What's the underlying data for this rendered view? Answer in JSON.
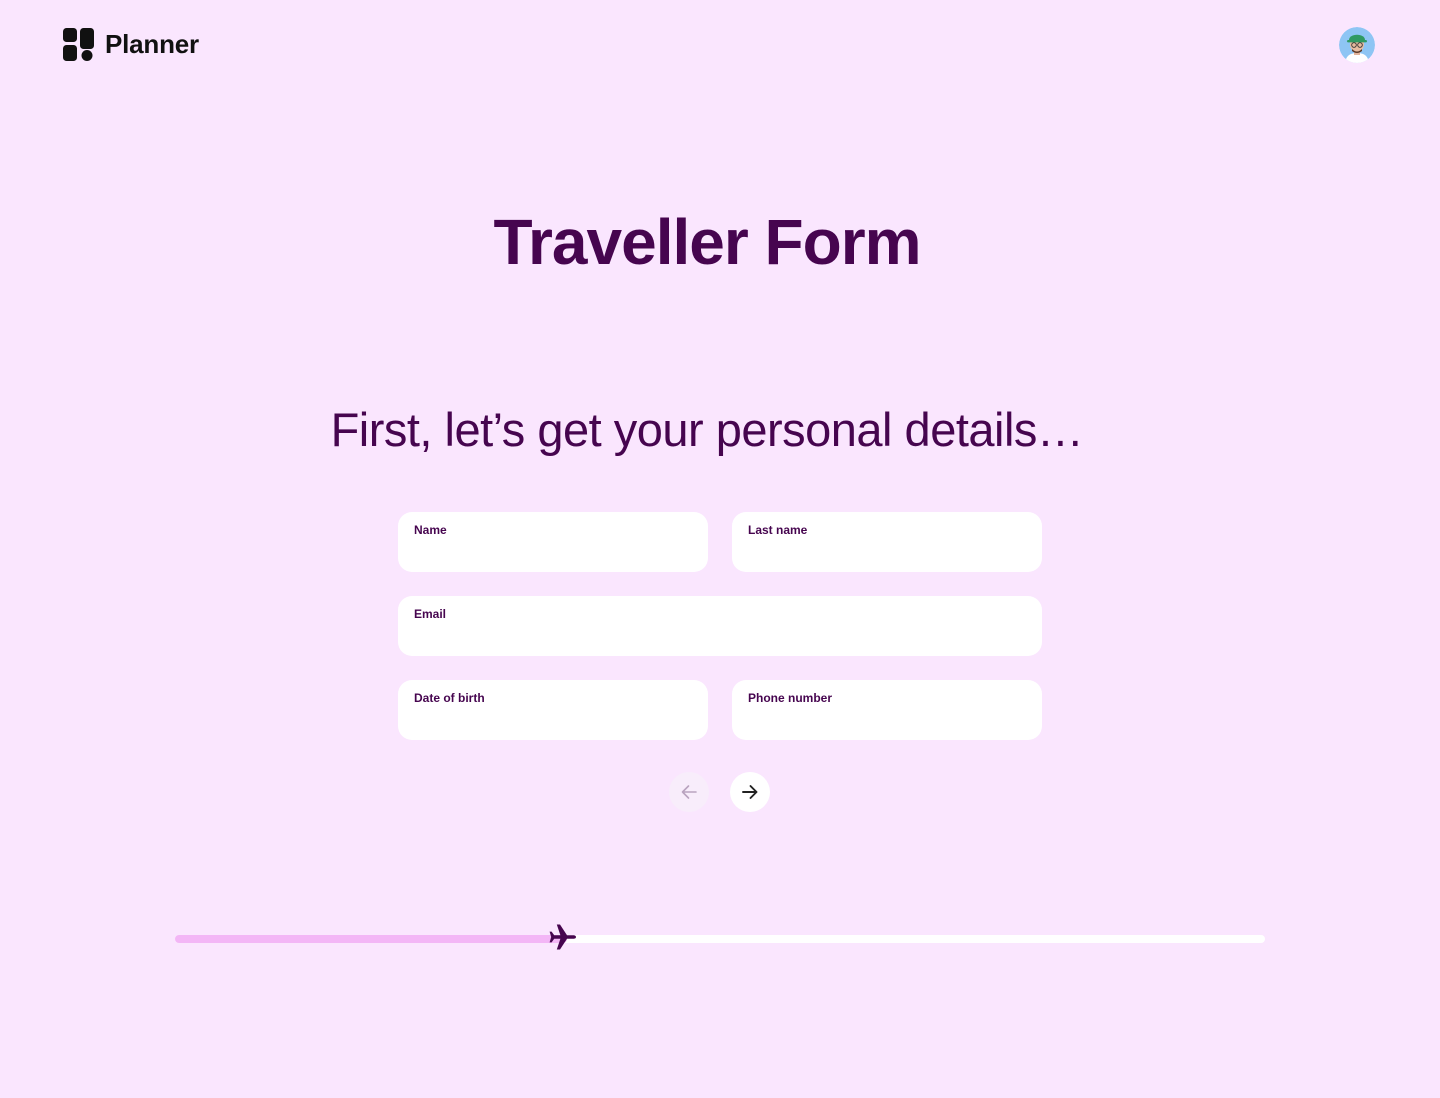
{
  "app": {
    "name": "Planner",
    "logo_icon": "planner-logo-icon",
    "avatar_icon": "user-avatar-icon"
  },
  "page": {
    "title": "Traveller Form",
    "subtitle": "First, let’s get your personal details…"
  },
  "form": {
    "fields": {
      "name": {
        "label": "Name",
        "value": ""
      },
      "last_name": {
        "label": "Last name",
        "value": ""
      },
      "email": {
        "label": "Email",
        "value": ""
      },
      "date_of_birth": {
        "label": "Date of birth",
        "value": ""
      },
      "phone_number": {
        "label": "Phone number",
        "value": ""
      }
    }
  },
  "navigation": {
    "prev_icon": "arrow-left-icon",
    "next_icon": "arrow-right-icon",
    "prev_enabled": false,
    "next_enabled": true
  },
  "progress": {
    "fraction": 0.36,
    "marker_icon": "airplane-icon"
  },
  "colors": {
    "background": "#FAE6FE",
    "primary": "#46054F",
    "progress_fill": "#F3B6F6",
    "progress_track": "#FFFFFF"
  }
}
